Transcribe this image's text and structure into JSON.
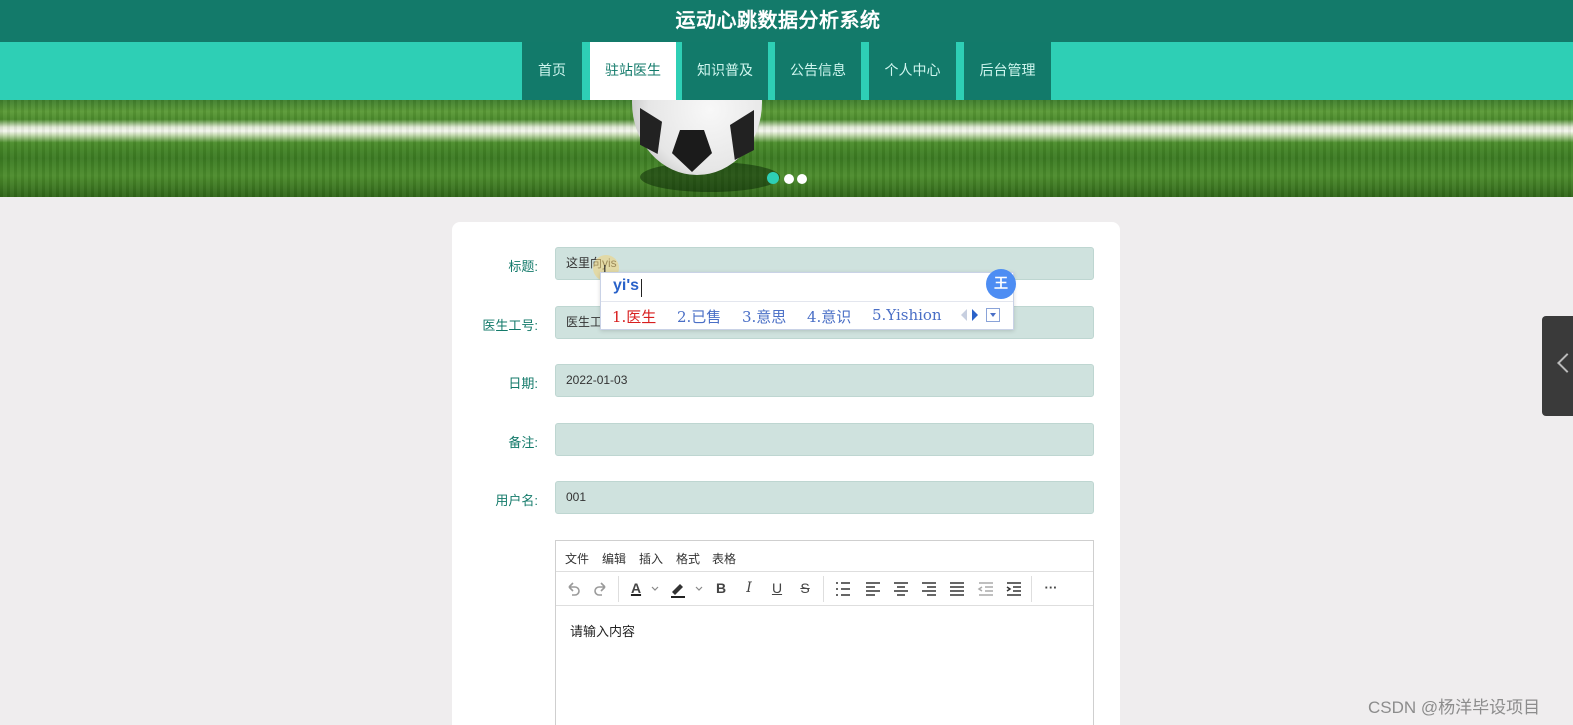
{
  "header": {
    "site_title": "运动心跳数据分析系统"
  },
  "nav": {
    "items": [
      {
        "label": "首页",
        "active": false
      },
      {
        "label": "驻站医生",
        "active": true
      },
      {
        "label": "知识普及",
        "active": false
      },
      {
        "label": "公告信息",
        "active": false
      },
      {
        "label": "个人中心",
        "active": false
      },
      {
        "label": "后台管理",
        "active": false
      }
    ]
  },
  "banner": {
    "slide_count": 3,
    "active_slide": 1
  },
  "form": {
    "fields": [
      {
        "label": "标题:",
        "value": "这里向yis"
      },
      {
        "label": "医生工号:",
        "value": "医生工"
      },
      {
        "label": "日期:",
        "value": "2022-01-03"
      },
      {
        "label": "备注:",
        "value": ""
      },
      {
        "label": "用户名:",
        "value": "001"
      }
    ]
  },
  "editor": {
    "menu": [
      "文件",
      "编辑",
      "插入",
      "格式",
      "表格"
    ],
    "toolbar_icons": [
      "undo-icon",
      "redo-icon",
      "text-color-icon",
      "highlight-color-icon",
      "bold-icon",
      "italic-icon",
      "underline-icon",
      "strikethrough-icon",
      "list-icon",
      "align-left-icon",
      "align-center-icon",
      "align-right-icon",
      "align-justify-icon",
      "outdent-icon",
      "indent-icon",
      "more-icon"
    ],
    "bold_label": "B",
    "italic_label": "I",
    "underline_label": "U",
    "strike_label": "S",
    "text_color_label": "A",
    "more_label": "···",
    "placeholder": "请输入内容"
  },
  "ime": {
    "input": "yi's",
    "candidates": [
      "1.医生",
      "2.已售",
      "3.意思",
      "4.意识",
      "5.Yishion"
    ],
    "logo": "王"
  },
  "watermark": "CSDN @杨洋毕设项目",
  "colors": {
    "primary": "#137a6a",
    "nav": "#2ecfb5",
    "input_bg": "#cfe2de",
    "page_bg": "#efedee"
  }
}
